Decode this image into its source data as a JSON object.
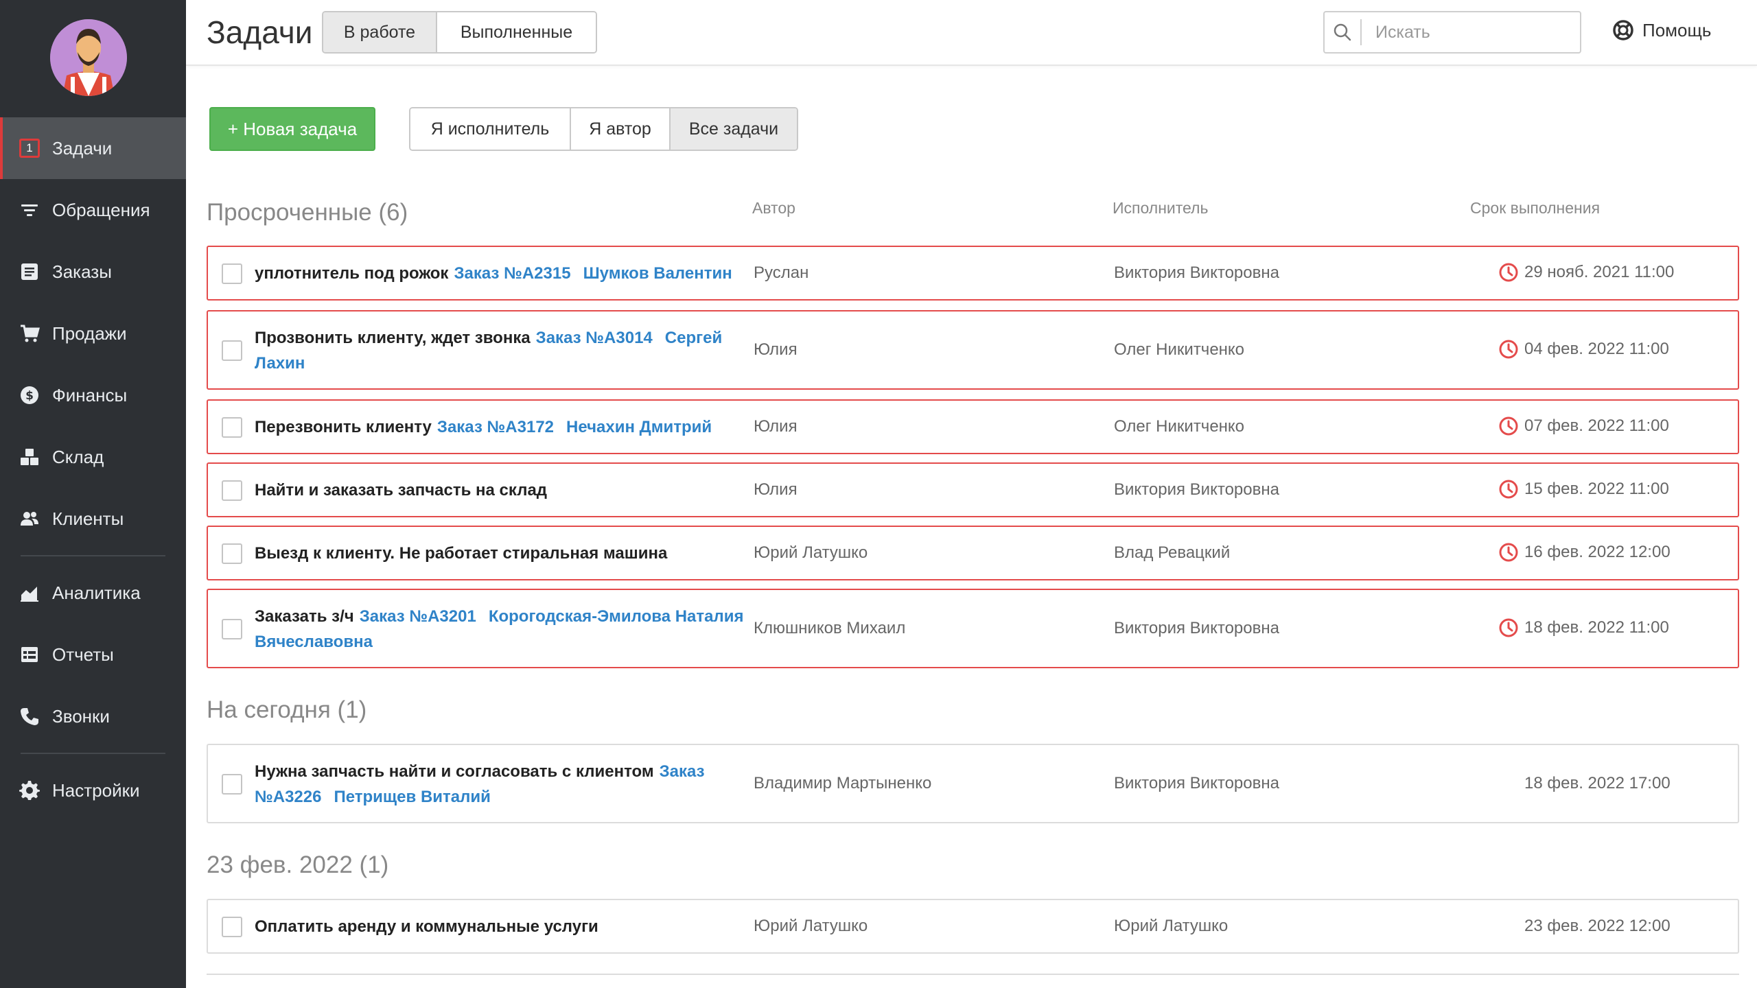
{
  "colors": {
    "sidebar_bg": "#2d3034",
    "active_item_bg": "#505357",
    "accent_red": "#dd3b3b",
    "green_button": "#5cb85c",
    "link_blue": "#2f83c8",
    "overdue_border": "#e44b4b"
  },
  "header": {
    "title": "Задачи",
    "status_tabs": [
      {
        "label": "В работе",
        "active": true
      },
      {
        "label": "Выполненные",
        "active": false
      }
    ],
    "search": {
      "placeholder": "Искать",
      "icon": "search-icon"
    },
    "help_label": "Помощь"
  },
  "sidebar": {
    "items": [
      {
        "label": "Задачи",
        "icon": "badge-counter-icon",
        "badge": "1",
        "active": true
      },
      {
        "label": "Обращения",
        "icon": "filter-icon"
      },
      {
        "label": "Заказы",
        "icon": "order-list-icon"
      },
      {
        "label": "Продажи",
        "icon": "cart-icon"
      },
      {
        "label": "Финансы",
        "icon": "dollar-coin-icon"
      },
      {
        "label": "Склад",
        "icon": "boxes-icon"
      },
      {
        "label": "Клиенты",
        "icon": "users-icon"
      },
      {
        "label": "Аналитика",
        "icon": "area-chart-icon"
      },
      {
        "label": "Отчеты",
        "icon": "table-icon"
      },
      {
        "label": "Звонки",
        "icon": "phone-icon"
      },
      {
        "label": "Настройки",
        "icon": "gear-icon"
      }
    ]
  },
  "toolbar": {
    "new_task_label": "+ Новая задача",
    "filters": [
      {
        "label": "Я исполнитель",
        "active": false
      },
      {
        "label": "Я автор",
        "active": false
      },
      {
        "label": "Все задачи",
        "active": true
      }
    ]
  },
  "columns": {
    "author": "Автор",
    "assignee": "Исполнитель",
    "due": "Срок выполнения"
  },
  "sections": [
    {
      "title": "Просроченные (6)",
      "tasks": [
        {
          "text": "уплотнитель под рожок",
          "order": "Заказ №А2315",
          "client": "Шумков Валентин",
          "author": "Руслан",
          "assignee": "Виктория Викторовна",
          "due": "29 нояб. 2021 11:00",
          "overdue": true
        },
        {
          "text": "Прозвонить клиенту, ждет звонка",
          "order": "Заказ №А3014",
          "client": "Сергей Лахин",
          "author": "Юлия",
          "assignee": "Олег Никитченко",
          "due": "04 фев. 2022 11:00",
          "overdue": true
        },
        {
          "text": "Перезвонить клиенту",
          "order": "Заказ №А3172",
          "client": "Нечахин Дмитрий",
          "author": "Юлия",
          "assignee": "Олег Никитченко",
          "due": "07 фев. 2022 11:00",
          "overdue": true
        },
        {
          "text": "Найти и заказать запчасть на склад",
          "order": "",
          "client": "",
          "author": "Юлия",
          "assignee": "Виктория Викторовна",
          "due": "15 фев. 2022 11:00",
          "overdue": true
        },
        {
          "text": "Выезд к клиенту. Не работает стиральная машина",
          "order": "",
          "client": "",
          "author": "Юрий Латушко",
          "assignee": "Влад Ревацкий",
          "due": "16 фев. 2022 12:00",
          "overdue": true
        },
        {
          "text": "Заказать з/ч",
          "order": "Заказ №А3201",
          "client": "Корогодская-Эмилова Наталия Вячеславовна",
          "author": "Клюшников Михаил",
          "assignee": "Виктория Викторовна",
          "due": "18 фев. 2022 11:00",
          "overdue": true
        }
      ]
    },
    {
      "title": "На сегодня (1)",
      "tasks": [
        {
          "text": "Нужна запчасть найти и согласовать с клиентом",
          "order": "Заказ №А3226",
          "client": "Петрищев Виталий",
          "author": "Владимир Мартыненко",
          "assignee": "Виктория Викторовна",
          "due": "18 фев. 2022 17:00",
          "overdue": false
        }
      ]
    },
    {
      "title": "23 фев. 2022 (1)",
      "tasks": [
        {
          "text": "Оплатить аренду и коммунальные услуги",
          "order": "",
          "client": "",
          "author": "Юрий Латушко",
          "assignee": "Юрий Латушко",
          "due": "23 фев. 2022 12:00",
          "overdue": false
        }
      ]
    }
  ]
}
